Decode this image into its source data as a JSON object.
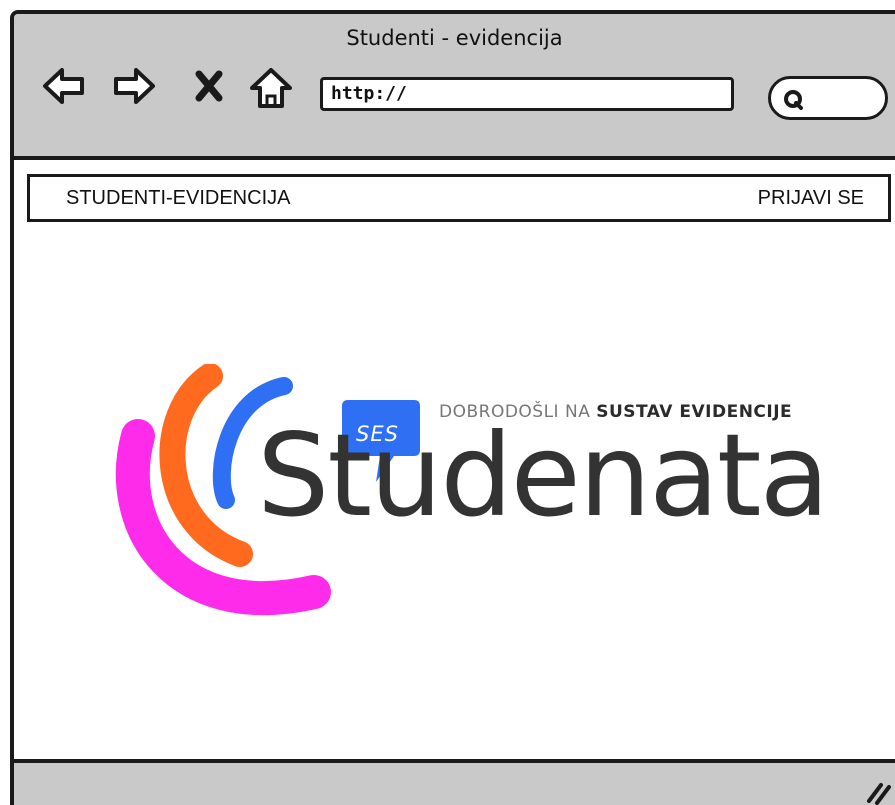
{
  "window": {
    "title": "Studenti - evidencija"
  },
  "toolbar": {
    "back_icon": "arrow-left-icon",
    "forward_icon": "arrow-right-icon",
    "stop_icon": "close-icon",
    "home_icon": "home-icon",
    "url": "http://",
    "search_icon": "search-icon"
  },
  "navbar": {
    "brand": "STUDENTI-EVIDENCIJA",
    "login": "PRIJAVI SE"
  },
  "hero": {
    "badge": "SES",
    "welcome_prefix": "DOBRODOŠLI NA",
    "welcome_strong": "SUSTAV EVIDENCIJE",
    "wordmark": "Studenata",
    "colors": {
      "blue": "#2f6ff3",
      "orange": "#ff6a1f",
      "magenta": "#ff2bea",
      "text": "#333333"
    }
  },
  "statusbar": {
    "grip_icon": "resize-grip-icon"
  }
}
